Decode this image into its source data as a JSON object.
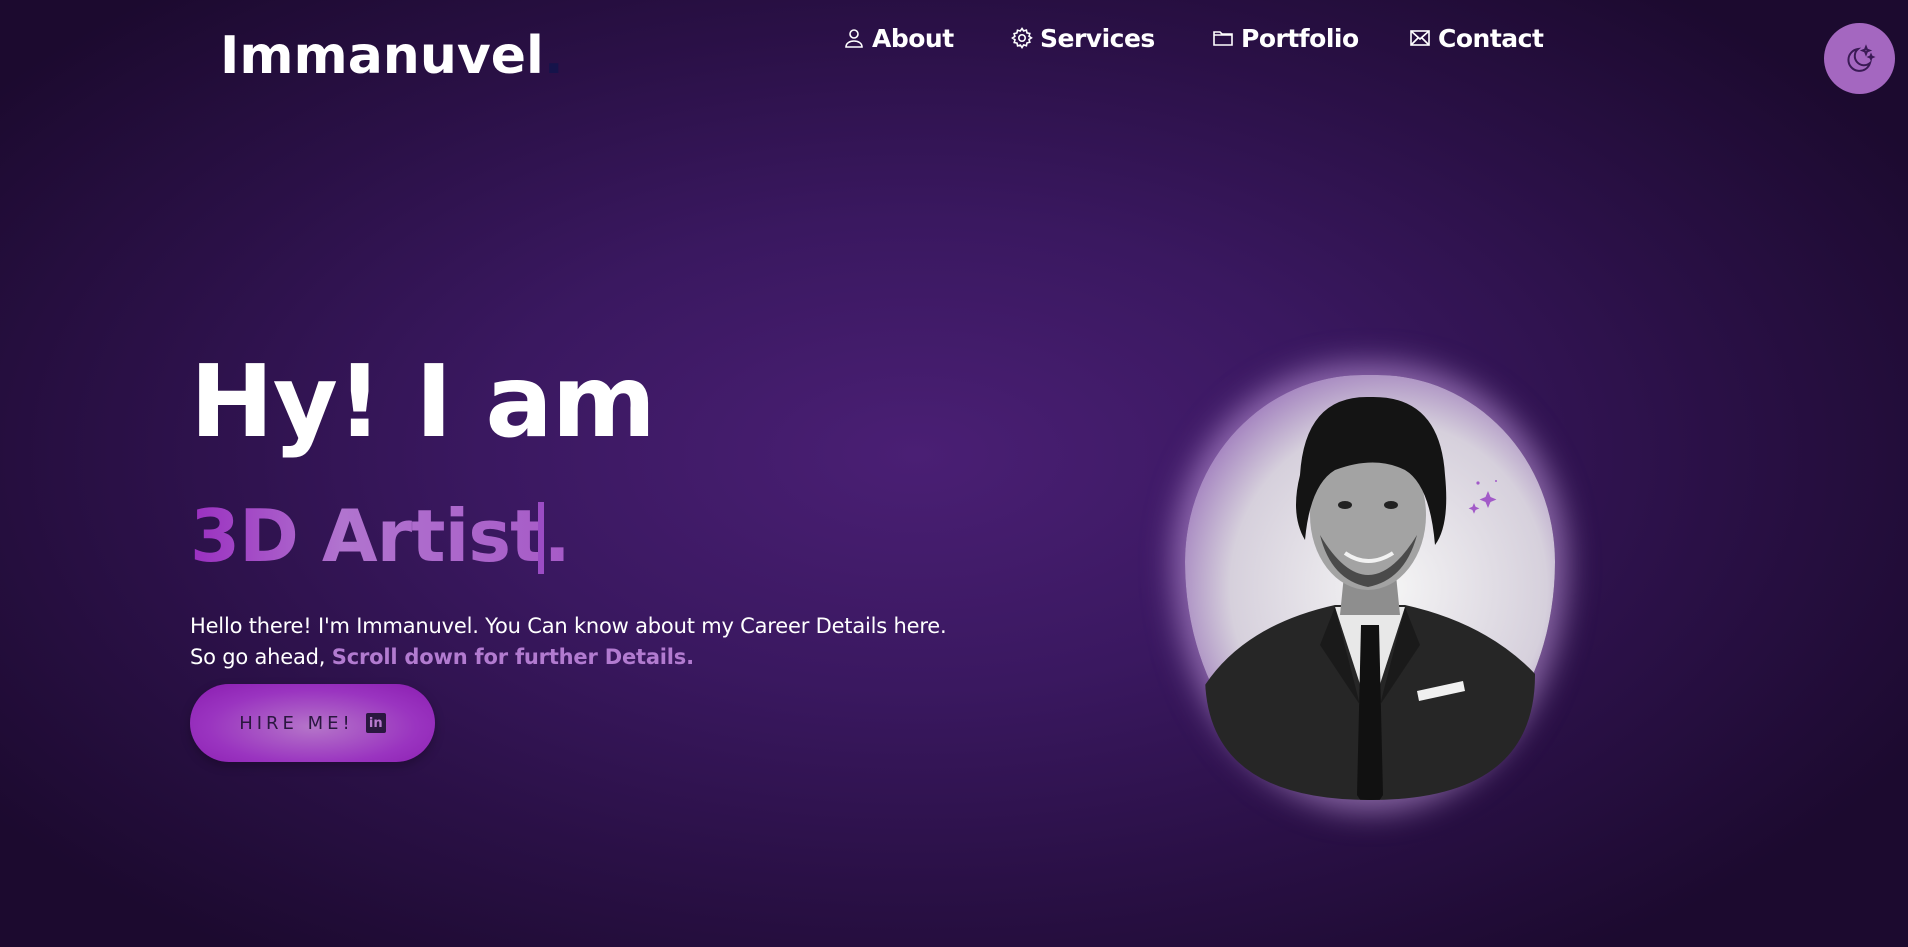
{
  "header": {
    "logo_text": "Immanuvel",
    "logo_dot": ".",
    "nav": [
      {
        "label": "About",
        "icon": "user-icon"
      },
      {
        "label": "Services",
        "icon": "gear-icon"
      },
      {
        "label": "Portfolio",
        "icon": "folder-icon"
      },
      {
        "label": "Contact",
        "icon": "envelope-icon"
      }
    ],
    "theme_toggle_icon": "moon-stars-icon"
  },
  "hero": {
    "title": "Hy! I am",
    "role": "3D Artist.",
    "intro_text": "Hello there! I'm Immanuvel. You Can know about my Career Details here. So go ahead, ",
    "intro_highlight": "Scroll down for further Details.",
    "cta_label": "HIRE ME!",
    "cta_icon": "linkedin-icon"
  },
  "colors": {
    "accent": "#a467c0",
    "highlight_text": "#b27bd0",
    "background_center": "#4a1f74",
    "background_edge": "#1c0a2f"
  }
}
